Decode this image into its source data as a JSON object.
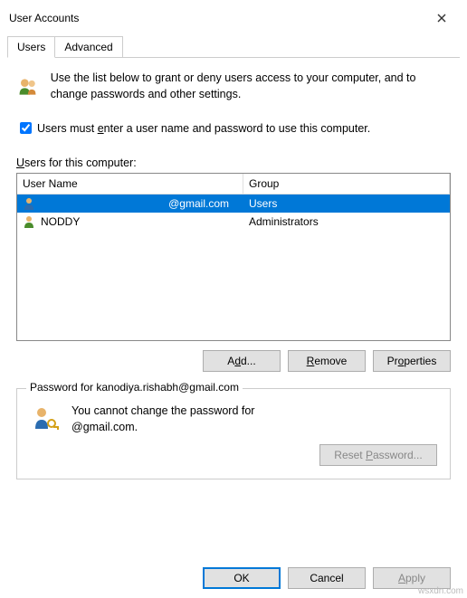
{
  "window": {
    "title": "User Accounts"
  },
  "tabs": [
    {
      "label": "Users",
      "active": true
    },
    {
      "label": "Advanced",
      "active": false
    }
  ],
  "info_text": "Use the list below to grant or deny users access to your computer, and to change passwords and other settings.",
  "checkbox": {
    "checked": true,
    "prefix": "Users must ",
    "u": "e",
    "rest": "nter a user name and password to use this computer."
  },
  "list_label_u": "U",
  "list_label_rest": "sers for this computer:",
  "columns": {
    "user": "User Name",
    "group": "Group"
  },
  "rows": [
    {
      "name": "@gmail.com",
      "group": "Users",
      "selected": true,
      "icon": "person-blue"
    },
    {
      "name": "NODDY",
      "group": "Administrators",
      "selected": false,
      "icon": "person-green"
    }
  ],
  "buttons": {
    "add": "Add...",
    "remove": "Remove",
    "properties": "Properties",
    "reset_password": "Reset Password...",
    "ok": "OK",
    "cancel": "Cancel",
    "apply": "Apply"
  },
  "fieldset": {
    "legend": "Password for kanodiya.rishabh@gmail.com",
    "text_line1": "You cannot change the password for",
    "text_line2": "@gmail.com."
  },
  "watermark": "wsxdn.com"
}
